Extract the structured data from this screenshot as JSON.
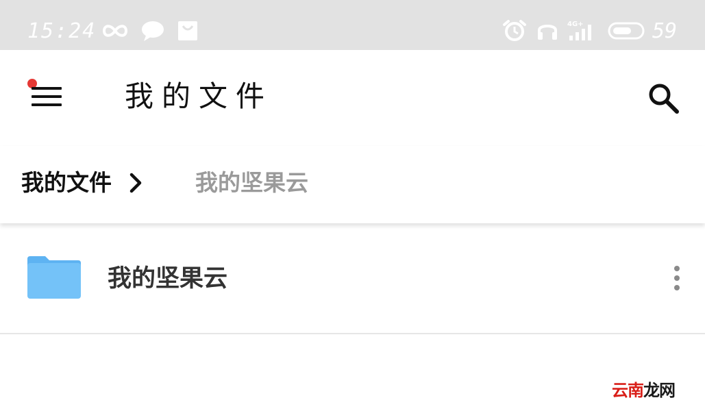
{
  "status_bar": {
    "time": "15:24",
    "battery_level": "59",
    "network_label": "4G+",
    "icons": [
      "infinity-icon",
      "chat-bubble-icon",
      "bag-icon",
      "alarm-icon",
      "headphones-icon",
      "signal-4g-icon",
      "battery-icon"
    ]
  },
  "app_bar": {
    "title": "我的文件",
    "menu_icon": "hamburger-menu-icon",
    "search_icon": "search-icon",
    "notification_dot_color": "#e53935"
  },
  "breadcrumb": {
    "items": [
      {
        "label": "我的文件",
        "active": true
      },
      {
        "label": "我的坚果云",
        "active": false
      }
    ],
    "separator_icon": "chevron-right-icon"
  },
  "files": [
    {
      "name": "我的坚果云",
      "type": "folder",
      "icon": "folder-icon",
      "more_icon": "more-vertical-icon"
    }
  ],
  "colors": {
    "folder": "#74c2f8",
    "folder_tab": "#5eb3f2",
    "status_bar_bg": "#e2e2e2",
    "inactive_crumb": "#9a9a9a"
  },
  "watermark": {
    "part1": "云南",
    "part2": "龙网"
  }
}
